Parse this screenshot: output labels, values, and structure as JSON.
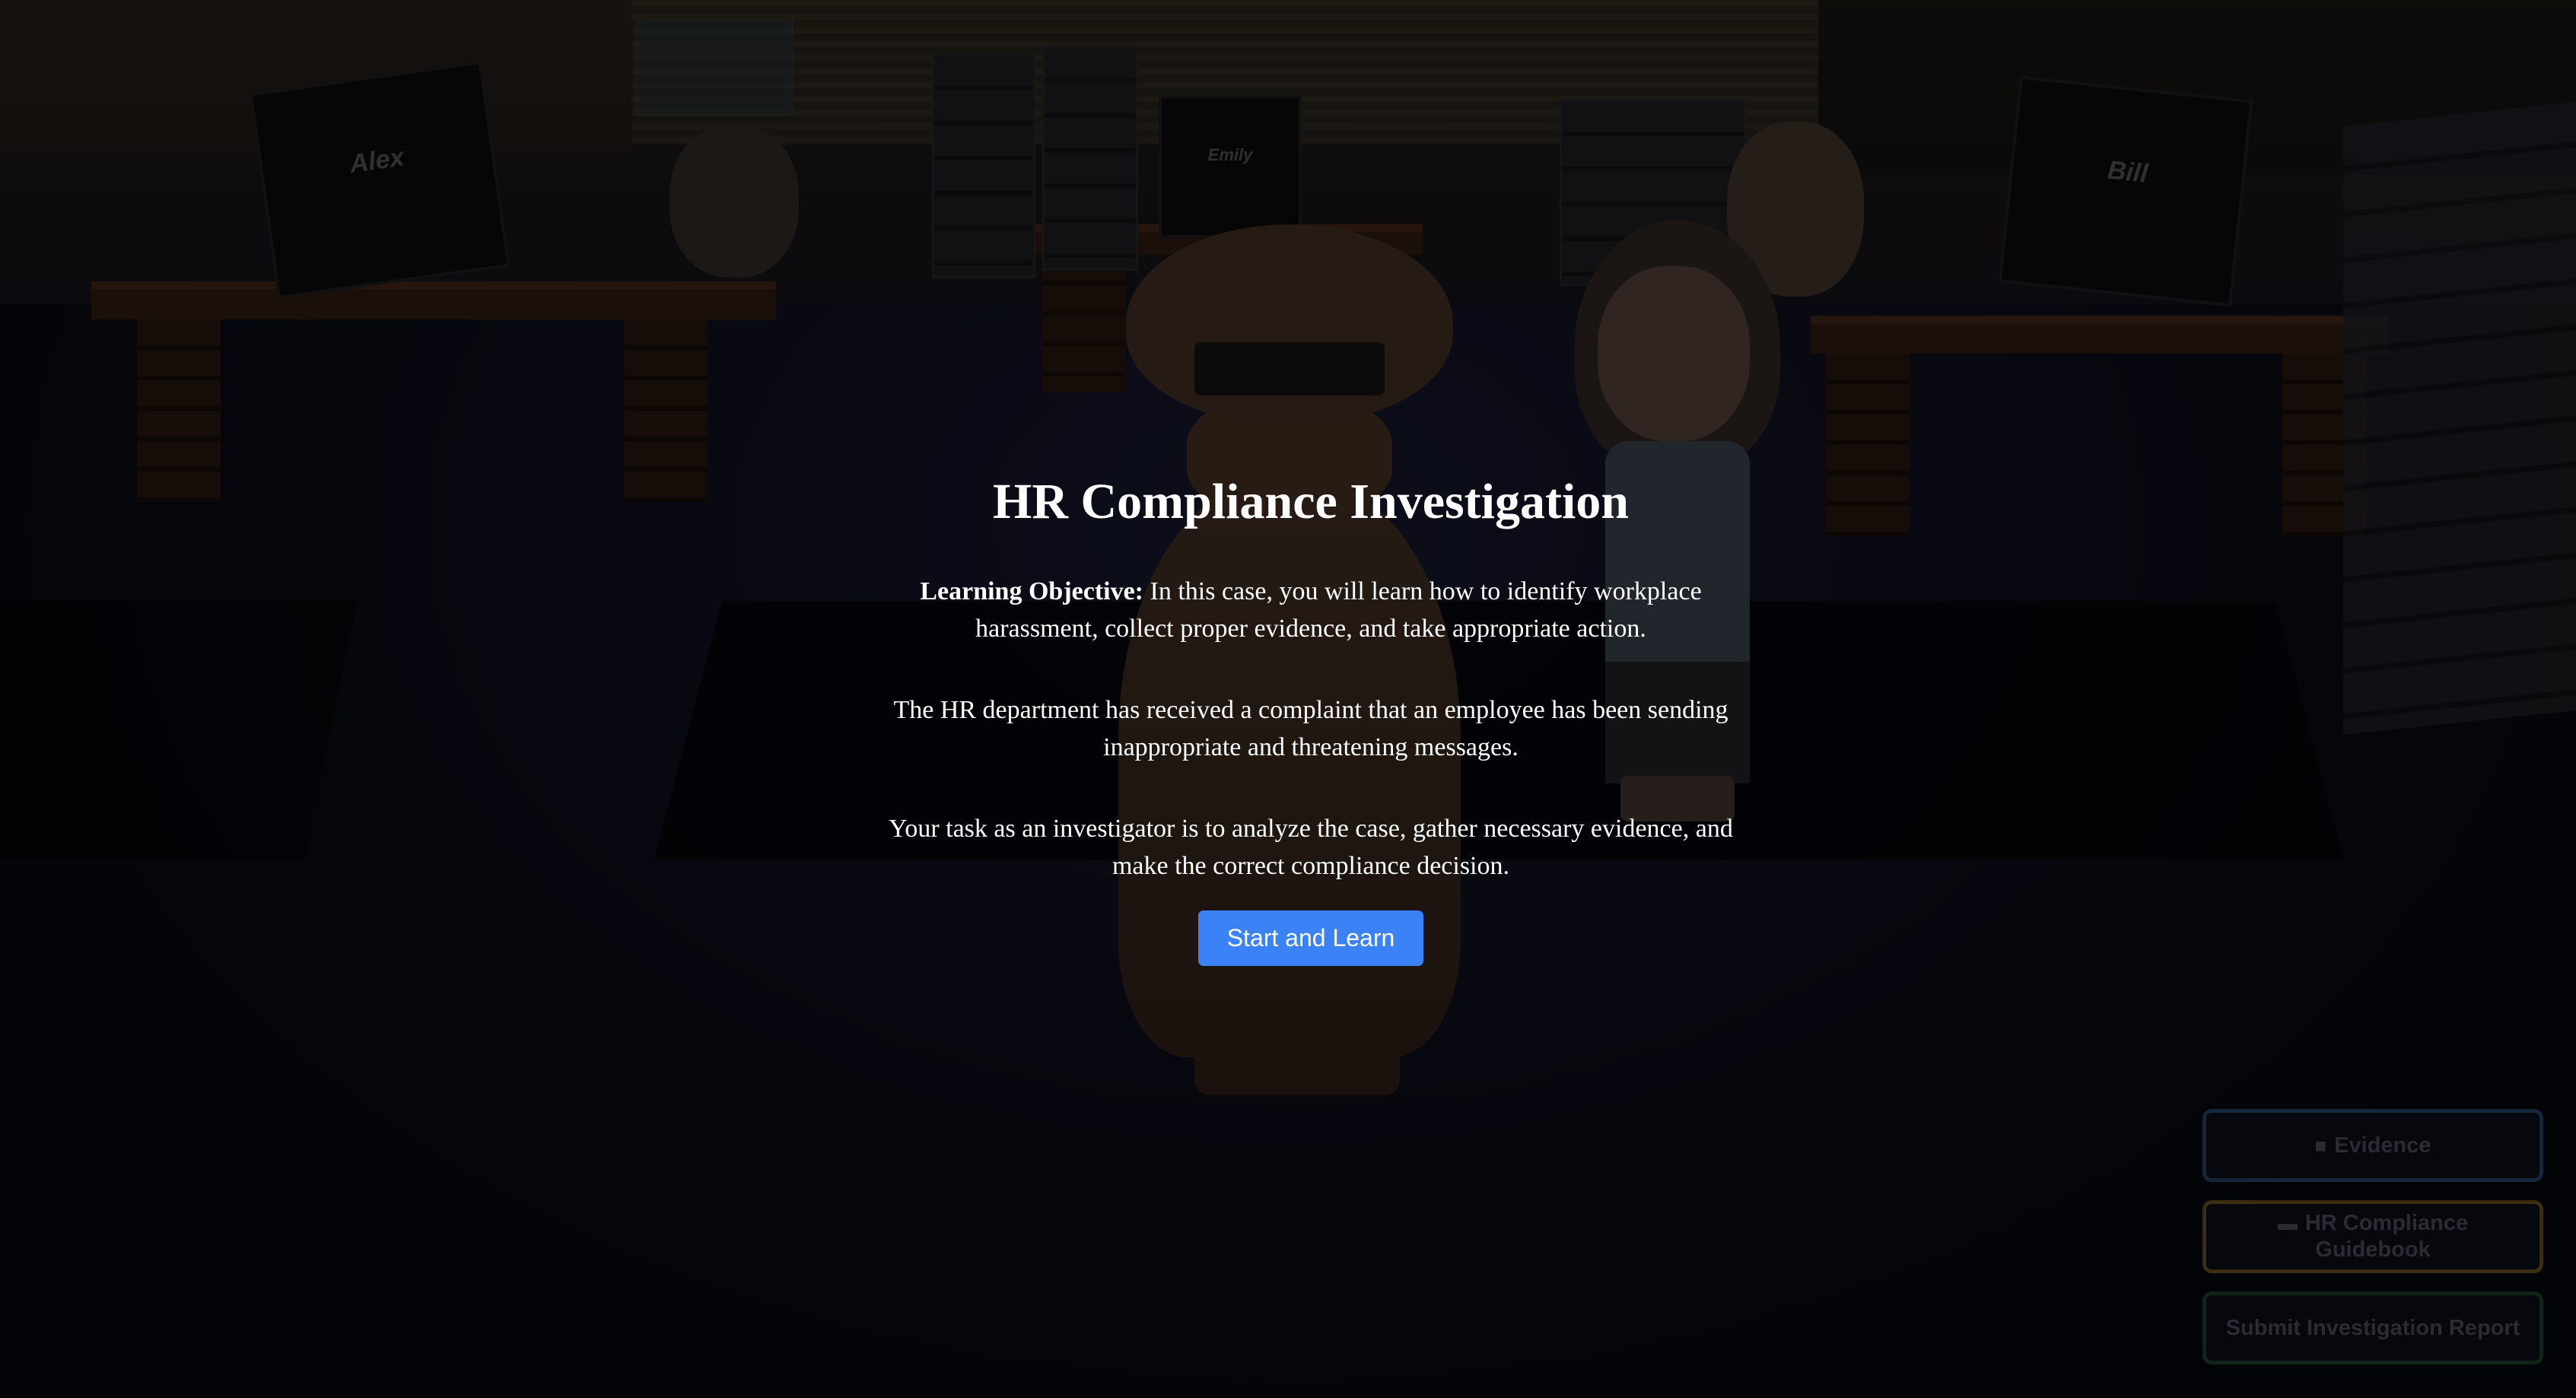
{
  "scene": {
    "monitor_labels": [
      "Alex",
      "Emily",
      "Bill"
    ]
  },
  "intro": {
    "title": "HR Compliance Investigation",
    "objective_label": "Learning Objective:",
    "objective_text": " In this case, you will learn how to identify workplace harassment, collect proper evidence, and take appropriate action.",
    "paragraph_complaint": "The HR department has received a complaint that an employee has been sending inappropriate and threatening messages.",
    "paragraph_task": "Your task as an investigator is to analyze the case, gather necessary evidence, and make the correct compliance decision.",
    "start_button": "Start and Learn"
  },
  "sidebar": {
    "evidence_icon": "briefcase-icon",
    "evidence_label": "Evidence",
    "guidebook_icon": "book-icon",
    "guidebook_label": "HR Compliance Guidebook",
    "submit_label": "Submit Investigation Report"
  },
  "colors": {
    "primary_button": "#3b82f6",
    "evidence_border": "#16263b",
    "guide_border": "#3a2d12",
    "submit_border": "#12241a"
  }
}
